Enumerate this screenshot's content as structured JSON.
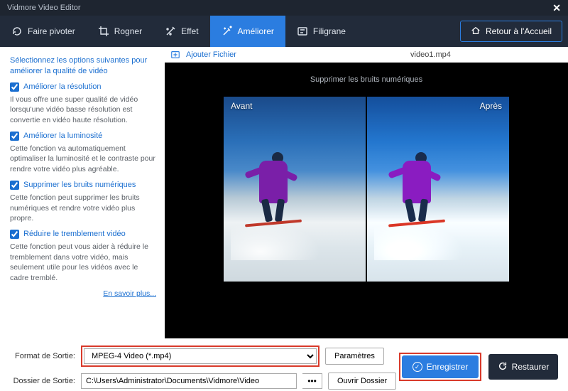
{
  "app": {
    "title": "Vidmore Video Editor"
  },
  "toolbar": {
    "rotate": "Faire pivoter",
    "crop": "Rogner",
    "effect": "Effet",
    "enhance": "Améliorer",
    "watermark": "Filigrane",
    "home": "Retour à l'Accueil"
  },
  "sidebar": {
    "intro": "Sélectionnez les options suivantes pour améliorer la qualité de vidéo",
    "opts": [
      {
        "label": "Améliorer la résolution",
        "desc": "Il vous offre une super qualité de vidéo lorsqu'une vidéo basse résolution est convertie en vidéo haute résolution."
      },
      {
        "label": "Améliorer la luminosité",
        "desc": "Cette fonction va automatiquement optimaliser la luminosité et le contraste pour rendre votre vidéo plus agréable."
      },
      {
        "label": "Supprimer les bruits numériques",
        "desc": "Cette fonction peut supprimer les bruits numériques et rendre votre vidéo plus propre."
      },
      {
        "label": "Réduire le tremblement vidéo",
        "desc": "Cette fonction peut vous aider à réduire le tremblement dans votre vidéo, mais seulement utile pour les vidéos avec le cadre tremblé."
      }
    ],
    "learn": "En savoir plus..."
  },
  "preview": {
    "add_file": "Ajouter Fichier",
    "filename": "video1.mp4",
    "caption": "Supprimer les bruits numériques",
    "before": "Avant",
    "after": "Après"
  },
  "bottom": {
    "format_label": "Format de Sortie:",
    "format_value": "MPEG-4 Video (*.mp4)",
    "settings": "Paramètres",
    "folder_label": "Dossier de Sortie:",
    "folder_value": "C:\\Users\\Administrator\\Documents\\Vidmore\\Video",
    "open_folder": "Ouvrir Dossier",
    "save": "Enregistrer",
    "restore": "Restaurer"
  }
}
